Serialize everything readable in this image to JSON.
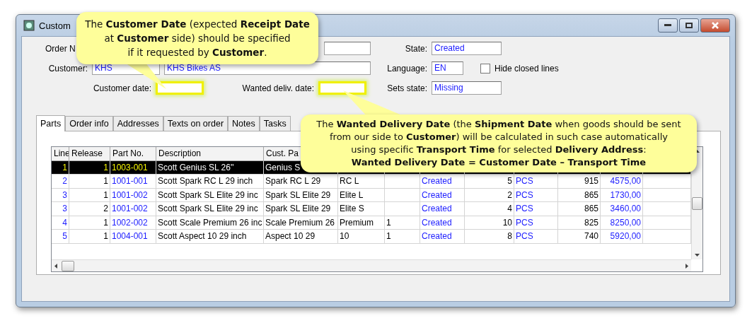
{
  "window": {
    "title": "Custom"
  },
  "form": {
    "order_label": "Order N",
    "customer_label": "Customer:",
    "customer_id": "KHS",
    "customer_name": "KHS Bikes AS",
    "customer_date_label": "Customer date:",
    "customer_date_highlighted": true,
    "wanted_date_label": "Wanted deliv. date:",
    "wanted_date_highlighted": true,
    "state_label": "State:",
    "state": "Created",
    "language_label": "Language:",
    "language": "EN",
    "hide_closed": {
      "label": "Hide closed lines",
      "checked": false
    },
    "sets_state_label": "Sets state:",
    "sets_state": "Missing"
  },
  "tabs": [
    {
      "label": "Parts",
      "selected": true
    },
    {
      "label": "Order info",
      "selected": false
    },
    {
      "label": "Addresses",
      "selected": false
    },
    {
      "label": "Texts on order",
      "selected": false
    },
    {
      "label": "Notes",
      "selected": false
    },
    {
      "label": "Tasks",
      "selected": false
    }
  ],
  "table": {
    "columns": [
      "Line",
      "Release",
      "Part No.",
      "Description",
      "Cust. Pa"
    ],
    "rows": [
      {
        "selected": true,
        "cells": [
          "1",
          "1",
          "1003-001",
          "Scott Genius SL 26''",
          "Genius S"
        ]
      },
      {
        "selected": false,
        "cells": [
          "2",
          "1",
          "1001-001",
          "Scott Spark RC L 29 inch",
          "Spark RC L 29",
          "RC L",
          "",
          "Created",
          "5",
          "PCS",
          "915",
          "4575,00"
        ]
      },
      {
        "selected": false,
        "cells": [
          "3",
          "1",
          "1001-002",
          "Scott Spark SL Elite 29 inc",
          "Spark SL Elite 29",
          "Elite L",
          "",
          "Created",
          "2",
          "PCS",
          "865",
          "1730,00"
        ]
      },
      {
        "selected": false,
        "cells": [
          "3",
          "2",
          "1001-002",
          "Scott Spark SL Elite 29 inc",
          "Spark SL Elite 29",
          "Elite S",
          "",
          "Created",
          "4",
          "PCS",
          "865",
          "3460,00"
        ]
      },
      {
        "selected": false,
        "cells": [
          "4",
          "1",
          "1002-002",
          "Scott Scale Premium 26 inc",
          "Scale Premium 26",
          "Premium",
          "1",
          "Created",
          "10",
          "PCS",
          "825",
          "8250,00"
        ]
      },
      {
        "selected": false,
        "cells": [
          "5",
          "1",
          "1004-001",
          "Scott Aspect 10 29 inch",
          "Aspect 10 29",
          "10",
          "1",
          "Created",
          "8",
          "PCS",
          "740",
          "5920,00"
        ]
      }
    ]
  },
  "callouts": [
    {
      "lines": [
        "The **Customer Date** (expected **Receipt Date**",
        "at **Customer** side) should be specified",
        "if it requested by **Customer**."
      ]
    },
    {
      "lines": [
        "The **Wanted Delivery Date** (the **Shipment Date** when goods should be sent",
        "from our side to **Customer**) will be calculated in such case automatically",
        "using specific **Transport Time** for selected **Delivery Address**:",
        "**Wanted Delivery Date = Customer Date – Transport Time**"
      ]
    }
  ]
}
